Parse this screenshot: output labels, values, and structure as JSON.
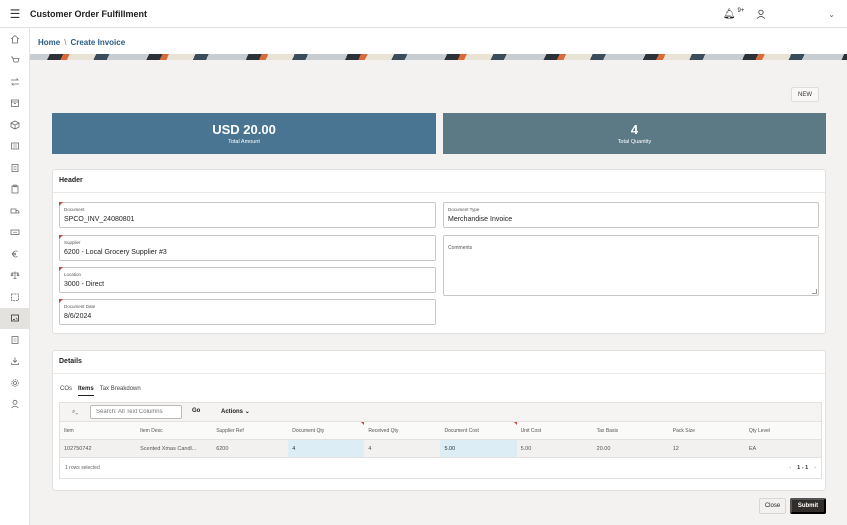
{
  "app": {
    "title": "Customer Order Fulfillment",
    "notification_count": "9+"
  },
  "breadcrumb": {
    "home": "Home",
    "separator": "\\",
    "current": "Create Invoice"
  },
  "actions": {
    "new": "NEW",
    "close": "Close",
    "submit": "Submit"
  },
  "kpis": {
    "total_amount": {
      "value": "USD 20.00",
      "label": "Total Amount"
    },
    "total_quantity": {
      "value": "4",
      "label": "Total Quantity"
    }
  },
  "header": {
    "title": "Header",
    "document": {
      "label": "Document",
      "value": "SPCO_INV_24080801"
    },
    "supplier": {
      "label": "Supplier",
      "value": "6200 - Local Grocery Supplier #3"
    },
    "location": {
      "label": "Location",
      "value": "3000 - Direct"
    },
    "document_date": {
      "label": "Document Date",
      "value": "8/6/2024"
    },
    "document_type": {
      "label": "Document Type",
      "value": "Merchandise Invoice"
    },
    "comments": {
      "label": "Comments",
      "value": ""
    }
  },
  "details": {
    "title": "Details",
    "tabs": [
      "COs",
      "Items",
      "Tax Breakdown"
    ],
    "active_tab": "Items",
    "toolbar": {
      "search_placeholder": "Search: All Text Columns",
      "go": "Go",
      "actions": "Actions"
    },
    "columns": [
      "Item",
      "Item Desc",
      "Supplier Ref",
      "Document Qty",
      "Received Qty",
      "Document Cost",
      "Unit Cost",
      "Tax Basis",
      "Pack Size",
      "Qty Level"
    ],
    "rows": [
      [
        "102750742",
        "Scented Xmas Candl...",
        "6200",
        "4",
        "4",
        "5.00",
        "5.00",
        "20.00",
        "12",
        "EA"
      ]
    ],
    "footer": {
      "selection": "1 rows selected",
      "pagination": "1 - 1"
    }
  }
}
